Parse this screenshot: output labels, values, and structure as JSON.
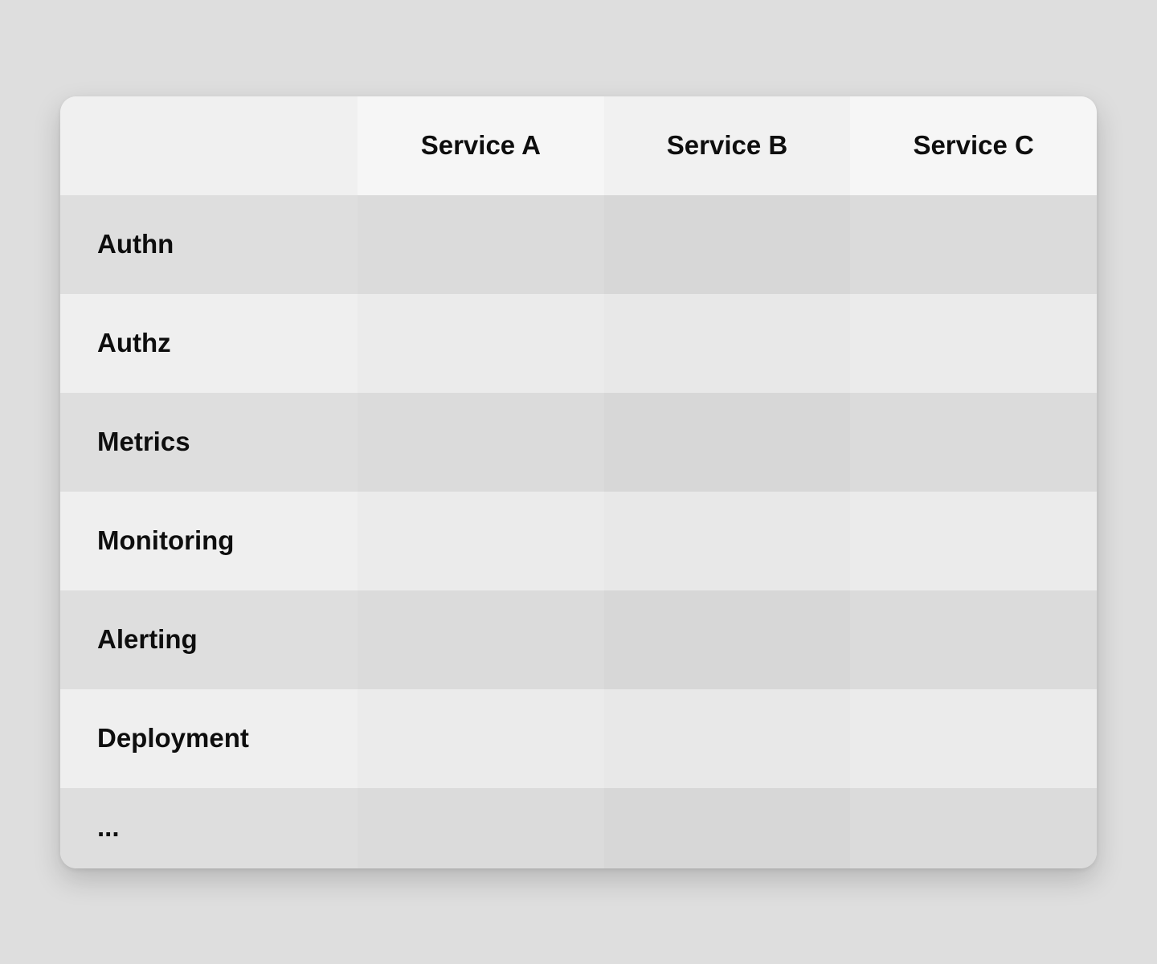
{
  "table": {
    "columns": [
      "Service A",
      "Service B",
      "Service C"
    ],
    "rows": [
      {
        "label": "Authn"
      },
      {
        "label": "Authz"
      },
      {
        "label": "Metrics"
      },
      {
        "label": "Monitoring"
      },
      {
        "label": "Alerting"
      },
      {
        "label": "Deployment"
      },
      {
        "label": "..."
      }
    ]
  }
}
